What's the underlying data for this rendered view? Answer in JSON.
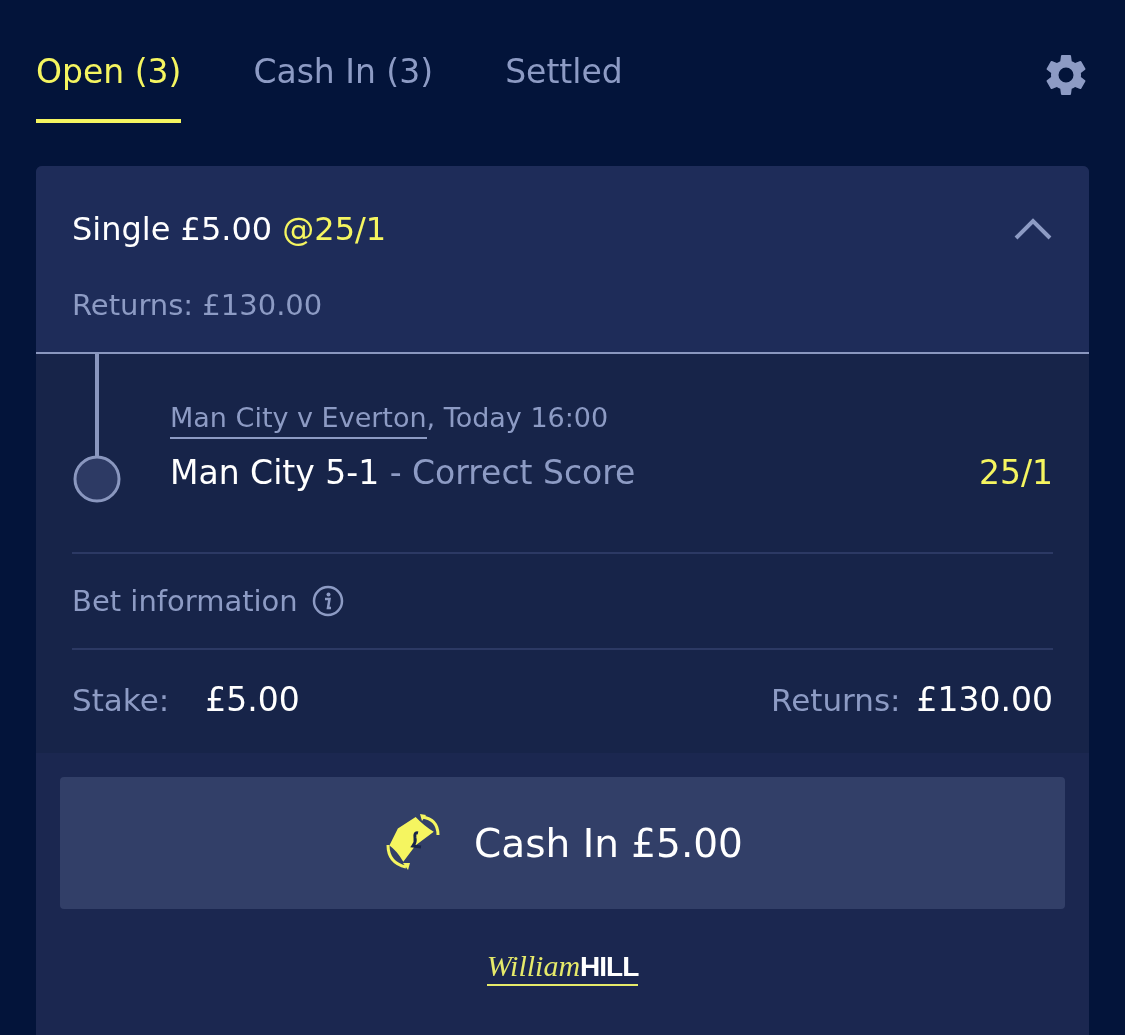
{
  "tabs": [
    {
      "label": "Open (3)",
      "selected": true
    },
    {
      "label": "Cash In (3)",
      "selected": false
    },
    {
      "label": "Settled",
      "selected": false
    }
  ],
  "bet": {
    "type_stake": "Single £5.00",
    "odds": "@25/1",
    "returns": "Returns: £130.00",
    "expanded": true,
    "selection": {
      "event": "Man City v Everton",
      "time": ", Today 16:00",
      "pick": "Man City 5-1",
      "separator": " - ",
      "market": "Correct Score",
      "odds": "25/1"
    },
    "info_label": "Bet information",
    "stake_label": "Stake:",
    "stake_value": "£5.00",
    "returns_label": "Returns:",
    "returns_value": "£130.00"
  },
  "cash_in_button": "Cash In £5.00",
  "logo": {
    "script": "William",
    "block": "HILL"
  }
}
